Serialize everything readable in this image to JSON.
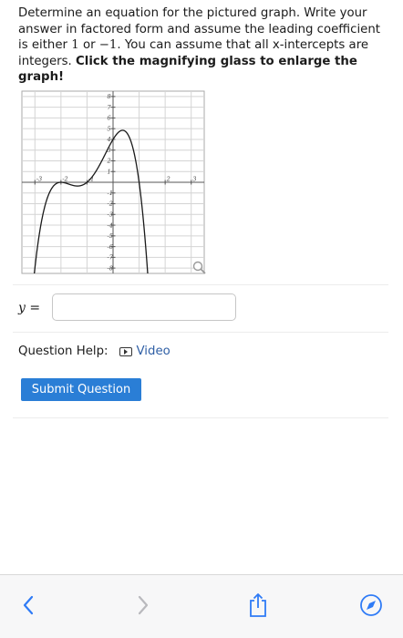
{
  "question": {
    "part1": "Determine an equation for the pictured graph. Write your answer in factored form and assume the leading coefficient is either ",
    "coef_pos": "1",
    "part2": " or ",
    "coef_neg": "−1",
    "part3": ". You can assume that all x-intercepts are integers. ",
    "bold": "Click the magnifying glass to enlarge the graph!"
  },
  "graph": {
    "x_ticks": [
      "-3",
      "-2",
      "-1",
      "2",
      "3"
    ],
    "y_ticks": [
      "8",
      "7",
      "6",
      "5",
      "4",
      "3",
      "2",
      "1",
      "-1",
      "-2",
      "-3",
      "-4",
      "-5",
      "-6",
      "-7",
      "-8"
    ],
    "magnifier_icon": "magnifying-glass-icon",
    "curve_color": "#1a1a1a"
  },
  "answer": {
    "label": "y =",
    "value": "",
    "placeholder": ""
  },
  "help": {
    "label": "Question Help:",
    "video_label": "Video",
    "video_icon": "video-play-icon"
  },
  "submit": {
    "label": "Submit Question",
    "color": "#2a7ed6"
  },
  "toolbar": {
    "back_icon": "chevron-left-icon",
    "forward_icon": "chevron-right-icon",
    "share_icon": "share-icon",
    "compass_icon": "compass-icon",
    "accent": "#2f7bf6"
  }
}
